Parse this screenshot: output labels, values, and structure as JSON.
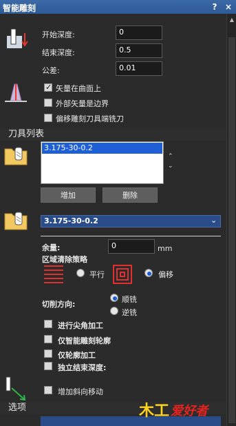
{
  "window": {
    "title": "智能雕刻",
    "help": "?",
    "close": "×"
  },
  "depth": {
    "start_label": "开始深度:",
    "start_value": "0",
    "end_label": "结束深度:",
    "end_value": "0.5",
    "tolerance_label": "公差:",
    "tolerance_value": "0.01"
  },
  "options": {
    "vector_on_surface": "矢量在曲面上",
    "outer_vector_boundary": "外部矢量是边界",
    "offset_end_mill": "偏移雕刻刀具端铣刀"
  },
  "tool_list": {
    "header": "刀具列表",
    "items": [
      "3.175-30-0.2"
    ],
    "add": "增加",
    "delete": "删除",
    "selected_tool": "3.175-30-0.2"
  },
  "params": {
    "allowance_label": "余量:",
    "allowance_value": "0",
    "allowance_unit": "mm",
    "strategy_label": "区域清除策略",
    "parallel": "平行",
    "offset": "偏移",
    "cut_dir_label": "切削方向:",
    "climb": "顺铣",
    "conventional": "逆铣",
    "corner": "进行尖角加工",
    "smart_contour": "仅智能雕刻轮廓",
    "contour_only": "仅轮廓加工",
    "independent_end_depth": "独立结束深度:",
    "ramp_move": "增加斜向移动"
  },
  "footer": {
    "section": "选项",
    "watermark": "爱好者",
    "watermark_prefix": "木工"
  },
  "colors": {
    "title_bar": "#2e5a96",
    "selection": "#1f5fd6",
    "strategy_red": "#e03030",
    "accent_radio": "#1d5fd0"
  }
}
